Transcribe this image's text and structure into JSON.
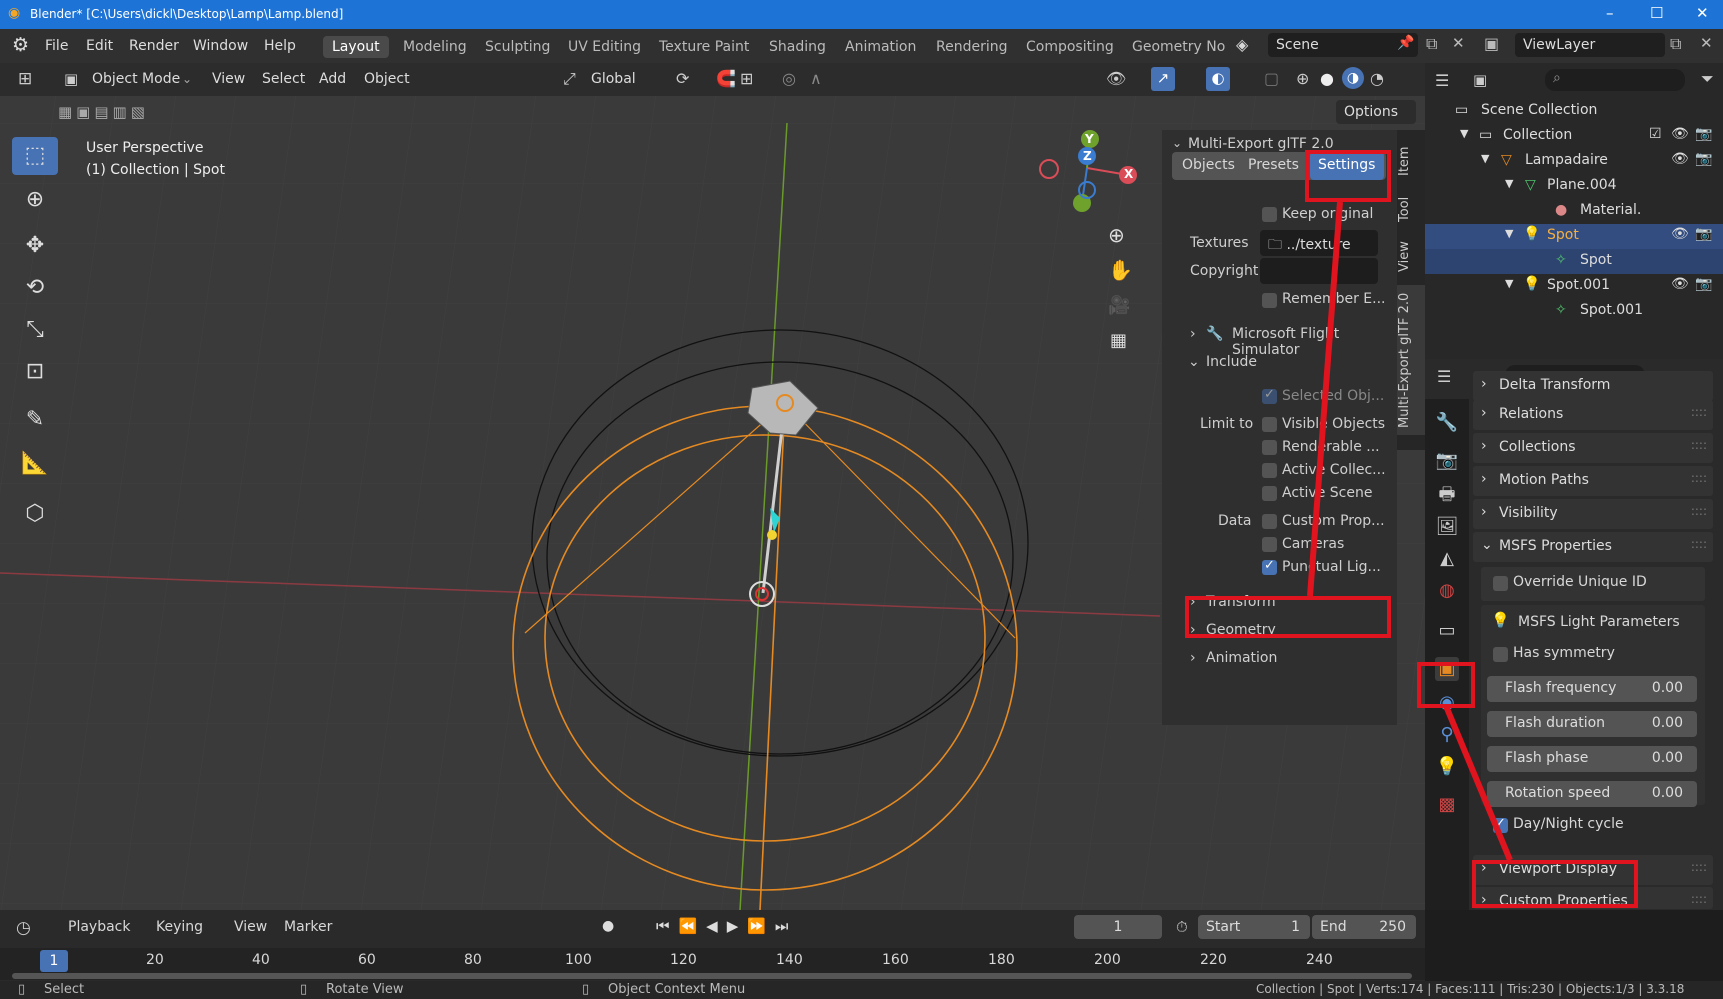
{
  "window": {
    "title": "Blender* [C:\\Users\\dickl\\Desktop\\Lamp\\Lamp.blend]"
  },
  "menubar": {
    "items": [
      "File",
      "Edit",
      "Render",
      "Window",
      "Help"
    ]
  },
  "workspaces": [
    "Layout",
    "Modeling",
    "Sculpting",
    "UV Editing",
    "Texture Paint",
    "Shading",
    "Animation",
    "Rendering",
    "Compositing",
    "Geometry No"
  ],
  "scene": {
    "name": "Scene",
    "viewlayer": "ViewLayer"
  },
  "viewport_header": {
    "mode": "Object Mode",
    "menus": [
      "View",
      "Select",
      "Add",
      "Object"
    ],
    "transform": "Global",
    "options": "Options"
  },
  "viewport": {
    "perspective": "User Perspective",
    "context": "(1) Collection | Spot",
    "axis_x": "X",
    "axis_y": "Y",
    "axis_z": "Z"
  },
  "npanel": {
    "title": "Multi-Export glTF 2.0",
    "tabs": [
      "Objects",
      "Presets",
      "Settings"
    ],
    "keep_original": "Keep original",
    "textures_label": "Textures",
    "textures_value": "../texture",
    "copyright_label": "Copyright",
    "remember": "Remember E...",
    "msfs": "Microsoft Flight Simulator",
    "include": "Include",
    "selected_obj": "Selected Obj...",
    "limit_to": "Limit to",
    "visible_objects": "Visible Objects",
    "renderable": "Renderable ...",
    "active_collec": "Active Collec...",
    "active_scene": "Active Scene",
    "data_label": "Data",
    "custom_prop": "Custom Prop...",
    "cameras": "Cameras",
    "punctual": "Punctual Lig...",
    "transform": "Transform",
    "geometry": "Geometry",
    "animation": "Animation"
  },
  "side_tabs": [
    "Item",
    "Tool",
    "View",
    "Multi-Export glTF 2.0"
  ],
  "outliner": {
    "scene_collection": "Scene Collection",
    "collection": "Collection",
    "lampadaire": "Lampadaire",
    "plane": "Plane.004",
    "material": "Material.",
    "spot": "Spot",
    "spot_data": "Spot",
    "spot001": "Spot.001",
    "spot001_data": "Spot.001"
  },
  "properties": {
    "sections": [
      "Delta Transform",
      "Relations",
      "Collections",
      "Motion Paths",
      "Visibility",
      "MSFS Properties"
    ],
    "override": "Override Unique ID",
    "light_params": "MSFS Light Parameters",
    "has_symmetry": "Has symmetry",
    "sliders": [
      {
        "name": "Flash frequency",
        "value": "0.00"
      },
      {
        "name": "Flash duration",
        "value": "0.00"
      },
      {
        "name": "Flash phase",
        "value": "0.00"
      },
      {
        "name": "Rotation speed",
        "value": "0.00"
      }
    ],
    "day_night": "Day/Night cycle",
    "bottom_sections": [
      "Viewport Display",
      "Custom Properties"
    ]
  },
  "timeline": {
    "menus": [
      "Playback",
      "Keying",
      "View",
      "Marker"
    ],
    "current_frame": "1",
    "start_label": "Start",
    "start": "1",
    "end_label": "End",
    "end": "250",
    "ticks": [
      "1",
      "20",
      "40",
      "60",
      "80",
      "100",
      "120",
      "140",
      "160",
      "180",
      "200",
      "220",
      "240"
    ]
  },
  "statusbar": {
    "select": "Select",
    "rotate": "Rotate View",
    "context_menu": "Object Context Menu",
    "stats": "Collection | Spot | Verts:174 | Faces:111 | Tris:230 | Objects:1/3 | 3.3.18"
  }
}
